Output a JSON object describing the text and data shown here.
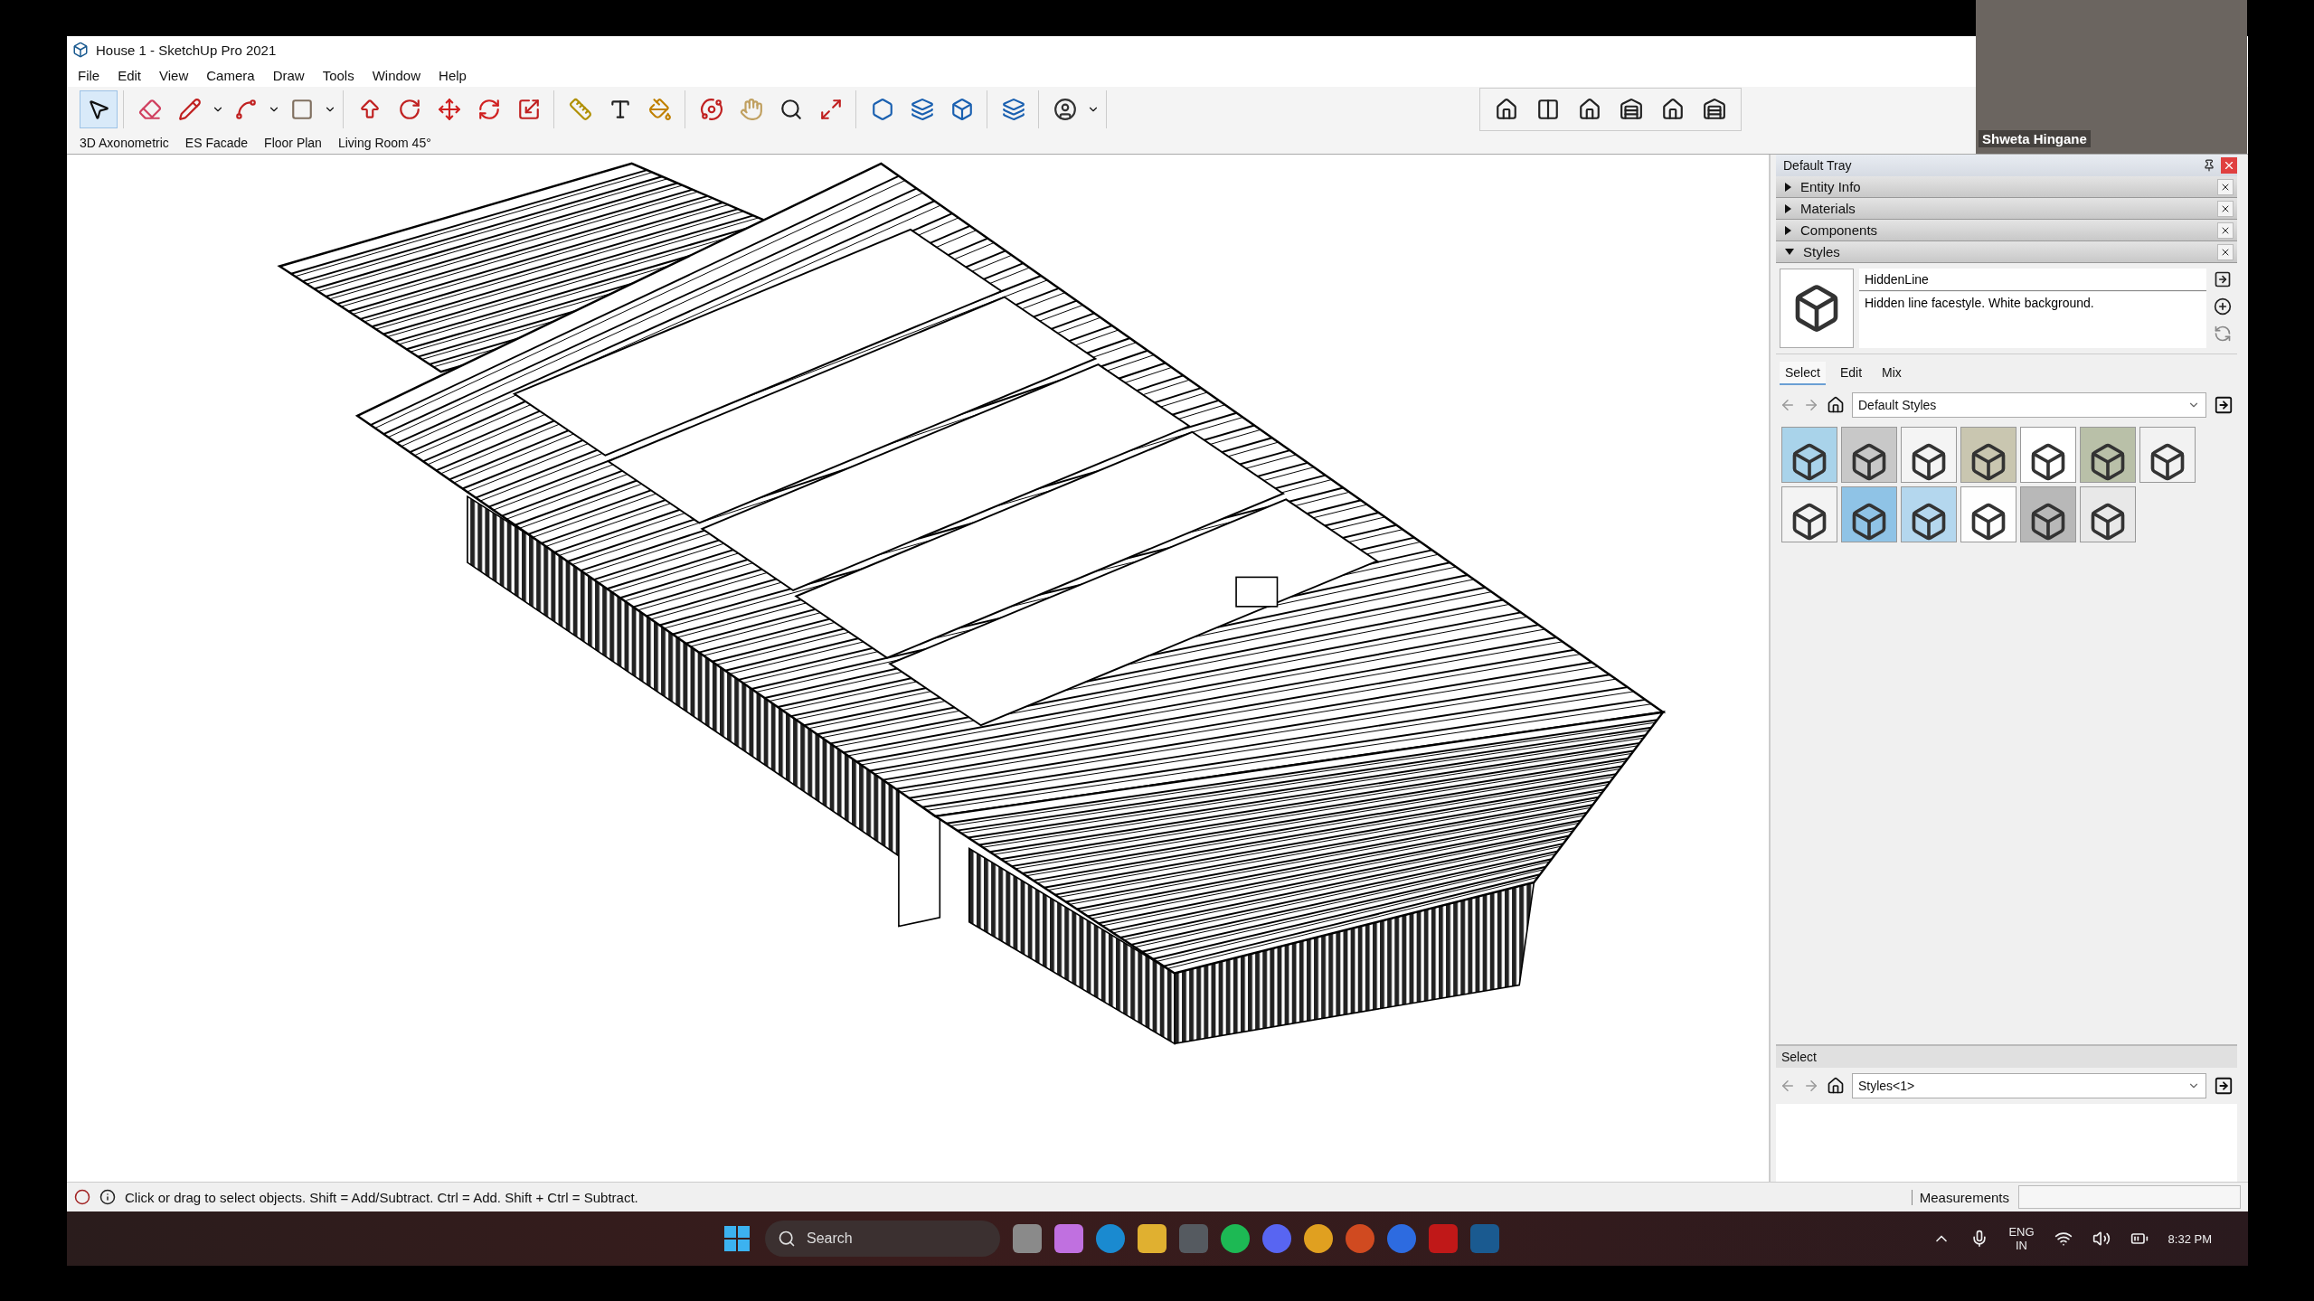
{
  "window": {
    "title": "House 1 - SketchUp Pro 2021"
  },
  "menu": [
    "File",
    "Edit",
    "View",
    "Camera",
    "Draw",
    "Tools",
    "Window",
    "Help"
  ],
  "scenes": [
    {
      "label": "3D Axonometric"
    },
    {
      "label": "ES Facade"
    },
    {
      "label": "Floor Plan"
    },
    {
      "label": "Living Room 45°"
    }
  ],
  "tray": {
    "title": "Default Tray",
    "panels": [
      {
        "label": "Entity Info",
        "expanded": false
      },
      {
        "label": "Materials",
        "expanded": false
      },
      {
        "label": "Components",
        "expanded": false
      },
      {
        "label": "Styles",
        "expanded": true
      }
    ],
    "style": {
      "name": "HiddenLine",
      "description": "Hidden line facestyle. White background."
    },
    "tabs": [
      {
        "label": "Select",
        "selected": true
      },
      {
        "label": "Edit",
        "selected": false
      },
      {
        "label": "Mix",
        "selected": false
      }
    ],
    "library": "Default Styles",
    "thumbnails": [
      {
        "color": "#a9d3ea"
      },
      {
        "color": "#c8c8c8"
      },
      {
        "color": "#f4f4f4"
      },
      {
        "color": "#c9c6b0"
      },
      {
        "color": "#ffffff"
      },
      {
        "color": "#b9c0a8"
      },
      {
        "color": "#f2f2f2"
      },
      {
        "color": "#f3f3f3"
      },
      {
        "color": "#8fc3e6"
      },
      {
        "color": "#b4d7ee"
      },
      {
        "color": "#fefefe"
      },
      {
        "color": "#b8b8b8"
      },
      {
        "color": "#e8e8e8"
      }
    ],
    "select_section": {
      "title": "Select",
      "library": "Styles<1>"
    }
  },
  "status_bar": {
    "hint": "Click or drag to select objects. Shift = Add/Subtract. Ctrl = Add. Shift + Ctrl = Subtract.",
    "measurements_label": "Measurements"
  },
  "taskbar": {
    "search_placeholder": "Search",
    "language": "ENG",
    "region": "IN",
    "time": "8:32 PM"
  },
  "video": {
    "name": "Shweta Hingane"
  }
}
